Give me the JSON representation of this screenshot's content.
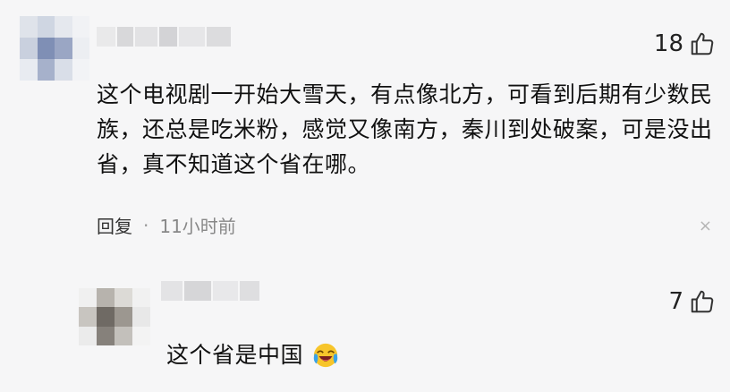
{
  "comments": [
    {
      "likes": "18",
      "text": "这个电视剧一开始大雪天，有点像北方，可看到后期有少数民族，还总是吃米粉，感觉又像南方，秦川到处破案，可是没出省，真不知道这个省在哪。",
      "reply_label": "回复",
      "separator": "·",
      "time": "11小时前",
      "close_icon": "×"
    },
    {
      "likes": "7",
      "text": "这个省是中国"
    }
  ],
  "icons": {
    "like": "thumbs-up-icon",
    "close": "close-icon",
    "emoji": "laughing-crying-emoji"
  }
}
